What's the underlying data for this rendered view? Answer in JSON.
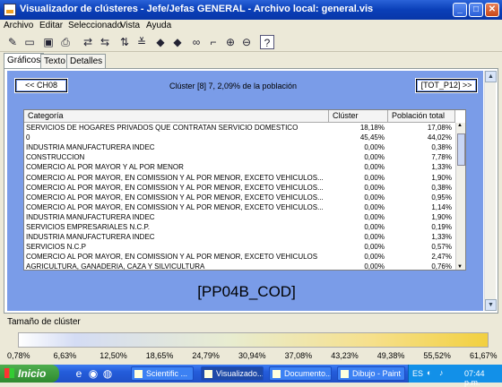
{
  "window": {
    "title": "Visualizador de clústeres - Jefe/Jefas GENERAL - Archivo local: general.vis",
    "minimize": "_",
    "maximize": "□",
    "close": "✕"
  },
  "menu": [
    "Archivo",
    "Editar",
    "Seleccionado",
    "Vista",
    "Ayuda"
  ],
  "toolbar_icons": [
    "new-icon",
    "open-icon",
    "save-icon",
    "print-icon",
    "swap-icon",
    "swap-back-icon",
    "sort-icon",
    "sort-alt-icon",
    "arrow-left-icon",
    "arrow-right-icon",
    "binoculars-icon",
    "chart-icon",
    "zoom-in-icon",
    "zoom-out-icon",
    "help-icon"
  ],
  "tabs": [
    "Gráficos",
    "Texto",
    "Detalles"
  ],
  "nav": {
    "prev": "<< CH08",
    "next": "[TOT_P12] >>",
    "cluster_info": "Clúster [8] 7, 2,09% de la población"
  },
  "table": {
    "headers": [
      "Categoría",
      "Clúster",
      "Población total"
    ],
    "rows": [
      [
        "SERVICIOS DE HOGARES PRIVADOS QUE CONTRATAN SERVICIO DOMESTICO",
        "18,18%",
        "17,08%"
      ],
      [
        "0",
        "45,45%",
        "44,02%"
      ],
      [
        "INDUSTRIA MANUFACTURERA INDEC",
        "0,00%",
        "0,38%"
      ],
      [
        "CONSTRUCCION",
        "0,00%",
        "7,78%"
      ],
      [
        "COMERCIO AL POR MAYOR Y AL POR MENOR",
        "0,00%",
        "1,33%"
      ],
      [
        "COMERCIO AL POR MAYOR, EN COMISSION Y AL POR MENOR, EXCETO VEHICULOS...",
        "0,00%",
        "1,90%"
      ],
      [
        "COMERCIO AL POR MAYOR, EN COMISSION Y AL POR MENOR, EXCETO VEHICULOS...",
        "0,00%",
        "0,38%"
      ],
      [
        "COMERCIO AL POR MAYOR, EN COMISSION Y AL POR MENOR, EXCETO VEHICULOS...",
        "0,00%",
        "0,95%"
      ],
      [
        "COMERCIO AL POR MAYOR, EN COMISSION Y AL POR MENOR, EXCETO VEHICULOS...",
        "0,00%",
        "1,14%"
      ],
      [
        "INDUSTRIA MANUFACTURERA INDEC",
        "0,00%",
        "1,90%"
      ],
      [
        "SERVICIOS EMPRESARIALES N.C.P.",
        "0,00%",
        "0,19%"
      ],
      [
        "INDUSTRIA MANUFACTURERA INDEC",
        "0,00%",
        "1,33%"
      ],
      [
        "SERVICIOS N.C.P",
        "0,00%",
        "0,57%"
      ],
      [
        "COMERCIO AL POR MAYOR, EN COMISSION Y AL POR MENOR, EXCETO VEHICULOS",
        "0,00%",
        "2,47%"
      ],
      [
        "AGRICULTURA, GANADERIA, CAZA Y SILVICULTURA",
        "0,00%",
        "0,76%"
      ]
    ]
  },
  "variable_name": "[PP04B_COD]",
  "size_legend": {
    "label": "Tamaño de clúster",
    "ticks": [
      "0,78%",
      "6,63%",
      "12,50%",
      "18,65%",
      "24,79%",
      "30,94%",
      "37,08%",
      "43,23%",
      "49,38%",
      "55,52%",
      "61,67%"
    ]
  },
  "taskbar": {
    "start": "Inicio",
    "tasks": [
      "Scientific ...",
      "Visualizado...",
      "Documento...",
      "Dibujo - Paint"
    ],
    "tray_lang": "ES",
    "clock": "07:44 p.m."
  }
}
